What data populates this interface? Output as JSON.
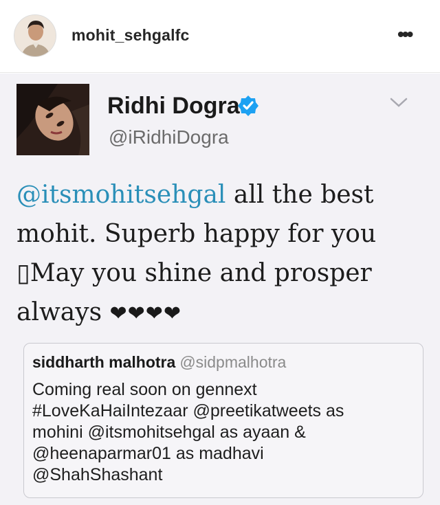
{
  "instagram": {
    "username": "mohit_sehgalfc",
    "more_icon": "more-horizontal-icon"
  },
  "tweet": {
    "name": "Ridhi Dogra",
    "handle": "@iRidhiDogra",
    "verified_icon": "verified-badge-icon",
    "menu_icon": "chevron-down-icon",
    "mention": "@itsmohitsehgal",
    "text_after_mention": " all the best mohit. Superb happy for you ▯May you shine and prosper always ",
    "hearts": "❤❤❤❤"
  },
  "quoted_tweet": {
    "name": "siddharth malhotra",
    "handle": "@sidpmalhotra",
    "lines": [
      "Coming real soon on gennext",
      "#LoveKaHaiIntezaar @preetikatweets as",
      "mohini @itsmohitsehgal as ayaan &",
      "@heenaparmar01 as madhavi",
      "@ShahShashant"
    ]
  },
  "colors": {
    "mention": "#2a8fb8",
    "verified": "#1da1f2"
  }
}
